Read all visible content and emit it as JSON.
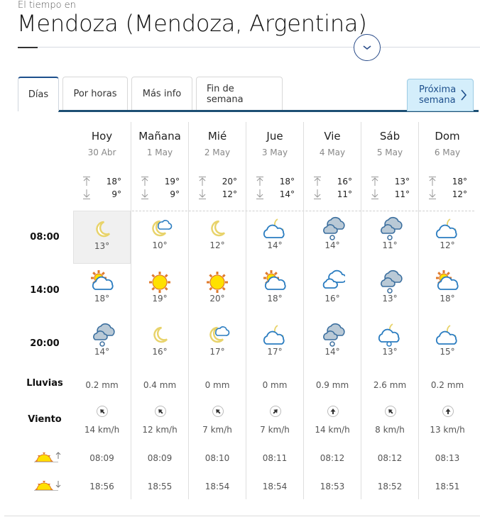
{
  "header": {
    "subtitle": "El tiempo en",
    "title": "Mendoza (Mendoza, Argentina)",
    "expand_icon": "chevron-down-icon"
  },
  "tabs": [
    {
      "label": "Días",
      "active": true
    },
    {
      "label": "Por horas",
      "active": false
    },
    {
      "label": "Más info",
      "active": false
    },
    {
      "label": "Fin de semana",
      "active": false
    }
  ],
  "next_week": {
    "line1": "Próxima",
    "line2": "semana",
    "icon": "chevron-right-icon"
  },
  "row_labels": {
    "h1": "08:00",
    "h2": "14:00",
    "h3": "20:00",
    "rain": "Lluvias",
    "wind": "Viento",
    "sunrise_icon": "sunrise-icon",
    "sunset_icon": "sunset-icon"
  },
  "days": [
    {
      "name": "Hoy",
      "date": "30 Abr",
      "max": "18°",
      "min": "9°",
      "hours": [
        {
          "icon": "moon",
          "temp": "13°"
        },
        {
          "icon": "sun-cloud",
          "temp": "18°"
        },
        {
          "icon": "rain-clouds",
          "temp": "14°"
        }
      ],
      "rain": "0.2 mm",
      "wind_dir": "NW",
      "wind": "14 km/h",
      "sunrise": "08:09",
      "sunset": "18:56"
    },
    {
      "name": "Mañana",
      "date": "1 May",
      "max": "19°",
      "min": "9°",
      "hours": [
        {
          "icon": "moon-cloud",
          "temp": "10°"
        },
        {
          "icon": "sun",
          "temp": "19°"
        },
        {
          "icon": "moon",
          "temp": "16°"
        }
      ],
      "rain": "0.4 mm",
      "wind_dir": "NW",
      "wind": "12 km/h",
      "sunrise": "08:09",
      "sunset": "18:55"
    },
    {
      "name": "Mié",
      "date": "2 May",
      "max": "20°",
      "min": "12°",
      "hours": [
        {
          "icon": "moon",
          "temp": "12°"
        },
        {
          "icon": "sun",
          "temp": "20°"
        },
        {
          "icon": "moon-cloud",
          "temp": "17°"
        }
      ],
      "rain": "0 mm",
      "wind_dir": "NW",
      "wind": "7 km/h",
      "sunrise": "08:10",
      "sunset": "18:54"
    },
    {
      "name": "Jue",
      "date": "3 May",
      "max": "18°",
      "min": "14°",
      "hours": [
        {
          "icon": "cloud-moon",
          "temp": "14°"
        },
        {
          "icon": "sun-cloud",
          "temp": "18°"
        },
        {
          "icon": "cloud-moon",
          "temp": "17°"
        }
      ],
      "rain": "0 mm",
      "wind_dir": "NE",
      "wind": "7 km/h",
      "sunrise": "08:11",
      "sunset": "18:54"
    },
    {
      "name": "Vie",
      "date": "4 May",
      "max": "16°",
      "min": "11°",
      "hours": [
        {
          "icon": "rain-clouds",
          "temp": "14°"
        },
        {
          "icon": "clouds",
          "temp": "16°"
        },
        {
          "icon": "rain-clouds",
          "temp": "14°"
        }
      ],
      "rain": "0.9 mm",
      "wind_dir": "N",
      "wind": "14 km/h",
      "sunrise": "08:12",
      "sunset": "18:53"
    },
    {
      "name": "Sáb",
      "date": "5 May",
      "max": "13°",
      "min": "11°",
      "hours": [
        {
          "icon": "rain-clouds",
          "temp": "11°"
        },
        {
          "icon": "rain-clouds",
          "temp": "13°"
        },
        {
          "icon": "cloud-moon-rain",
          "temp": "13°"
        }
      ],
      "rain": "2.6 mm",
      "wind_dir": "NW",
      "wind": "8 km/h",
      "sunrise": "08:12",
      "sunset": "18:52"
    },
    {
      "name": "Dom",
      "date": "6 May",
      "max": "18°",
      "min": "12°",
      "hours": [
        {
          "icon": "cloud-moon",
          "temp": "12°"
        },
        {
          "icon": "sun-cloud",
          "temp": "18°"
        },
        {
          "icon": "cloud-moon",
          "temp": "15°"
        }
      ],
      "rain": "0.2 mm",
      "wind_dir": "N",
      "wind": "13 km/h",
      "sunrise": "08:13",
      "sunset": "18:51"
    }
  ],
  "colors": {
    "accent": "#1d4f8c",
    "tab_rule": "#1d4f73",
    "next_week_bg": "#d4eefb",
    "moon": "#e8d36a",
    "cloud_stroke": "#2a7cc0",
    "rain_cloud_fill": "#b9c9d6",
    "sun_fill": "#ffe000",
    "sun_rays": "#e07a2b"
  }
}
